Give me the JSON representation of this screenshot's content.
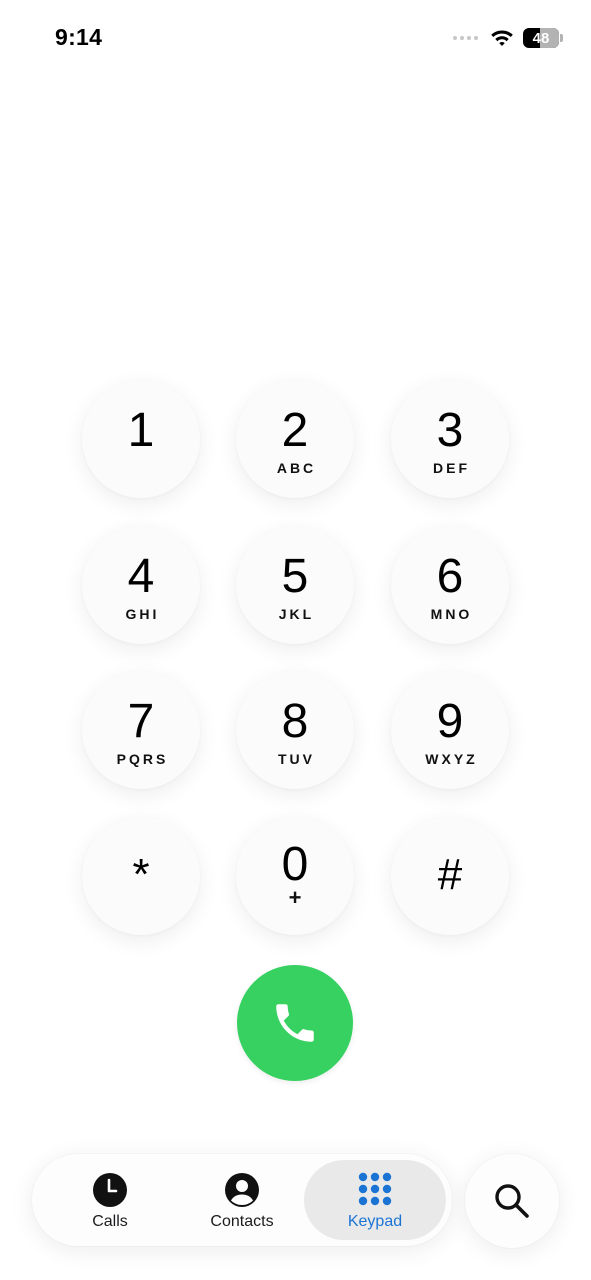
{
  "status_bar": {
    "time": "9:14",
    "battery_level": "48"
  },
  "keypad": {
    "keys": [
      {
        "digit": "1",
        "letters": ""
      },
      {
        "digit": "2",
        "letters": "ABC"
      },
      {
        "digit": "3",
        "letters": "DEF"
      },
      {
        "digit": "4",
        "letters": "GHI"
      },
      {
        "digit": "5",
        "letters": "JKL"
      },
      {
        "digit": "6",
        "letters": "MNO"
      },
      {
        "digit": "7",
        "letters": "PQRS"
      },
      {
        "digit": "8",
        "letters": "TUV"
      },
      {
        "digit": "9",
        "letters": "WXYZ"
      },
      {
        "digit": "*",
        "letters": ""
      },
      {
        "digit": "0",
        "letters": "+"
      },
      {
        "digit": "#",
        "letters": ""
      }
    ]
  },
  "call_button": {
    "icon": "phone-icon",
    "color": "#36d160"
  },
  "tabbar": {
    "tabs": [
      {
        "label": "Calls",
        "icon": "clock-icon",
        "active": false
      },
      {
        "label": "Contacts",
        "icon": "person-circle-icon",
        "active": false
      },
      {
        "label": "Keypad",
        "icon": "keypad-grid-icon",
        "active": true
      }
    ],
    "active_color": "#1b74d4",
    "search_icon": "search-icon"
  }
}
